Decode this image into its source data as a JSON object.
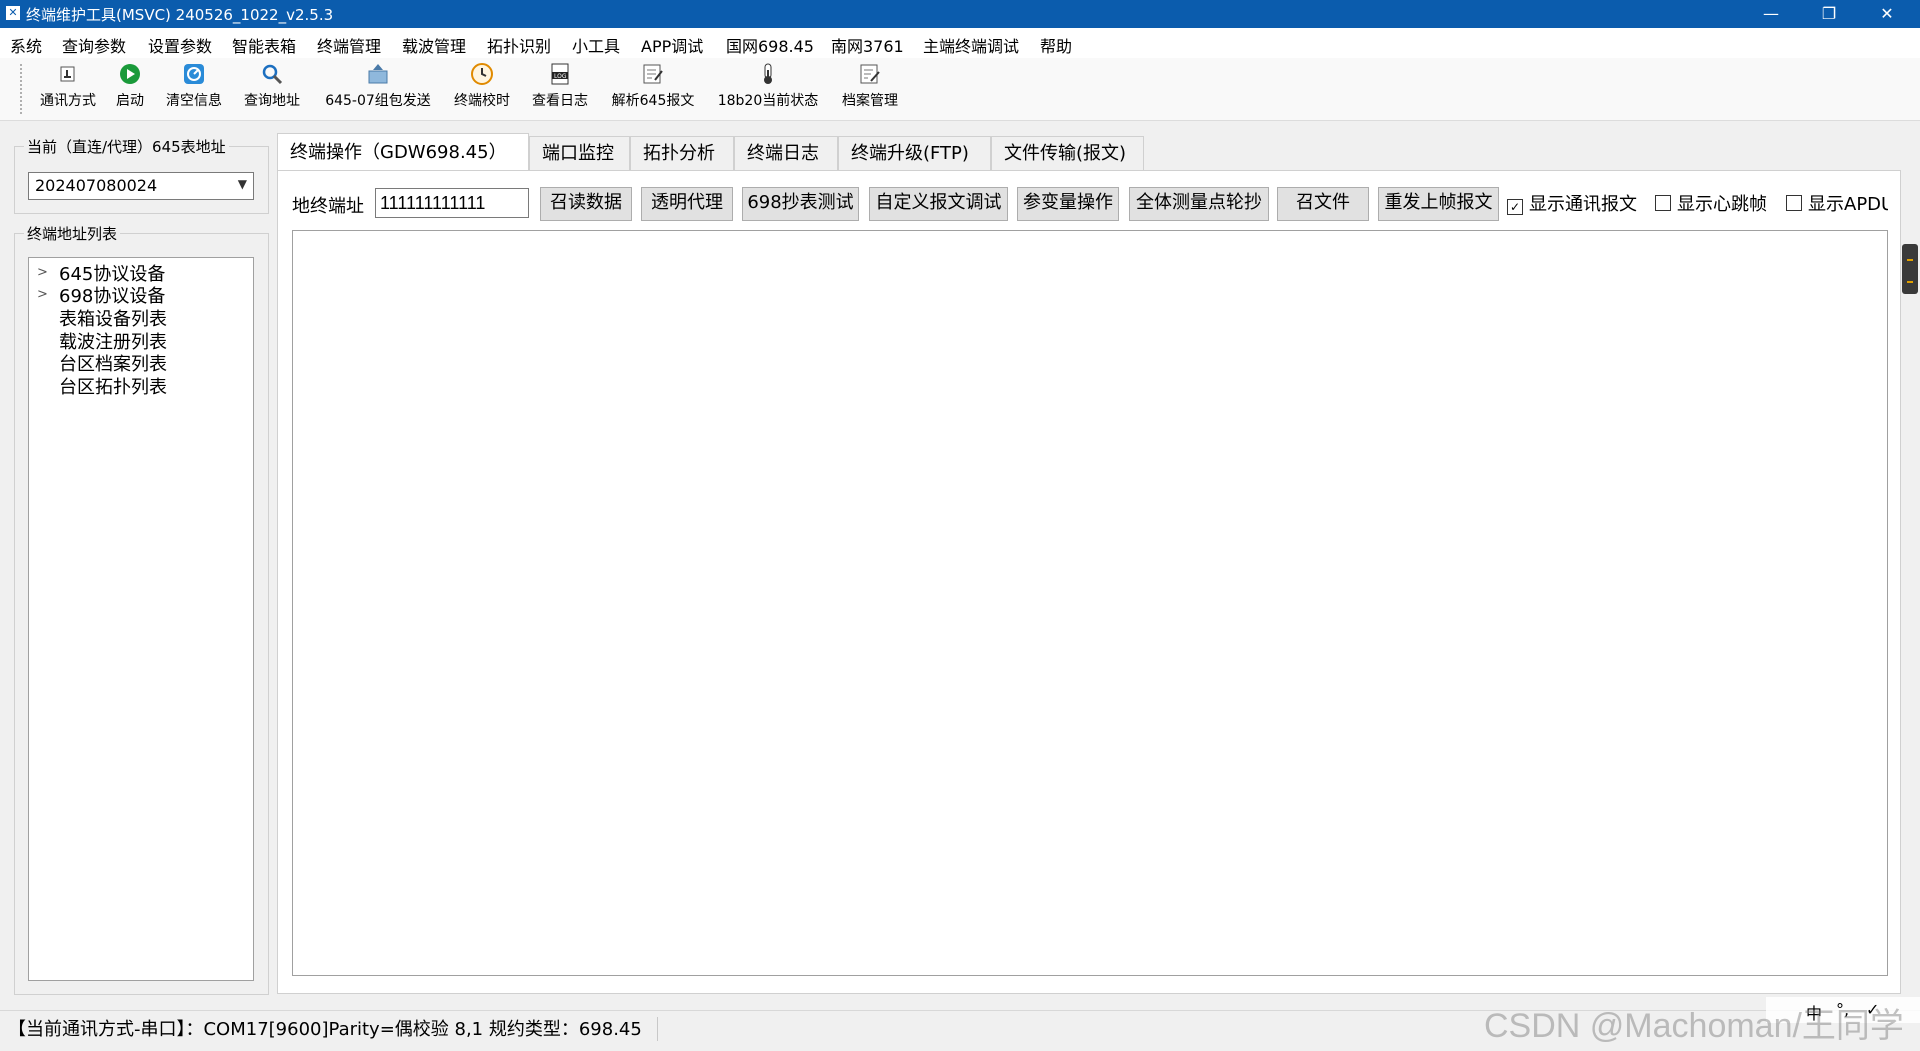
{
  "window": {
    "title": "终端维护工具(MSVC) 240526_1022_v2.5.3",
    "minimize": "—",
    "restore": "❐",
    "close": "✕"
  },
  "menu": [
    "系统",
    "查询参数",
    "设置参数",
    "智能表箱",
    "终端管理",
    "载波管理",
    "拓扑识别",
    "小工具",
    "APP调试",
    "国网698.45",
    "南网3761",
    "主端终端调试",
    "帮助"
  ],
  "toolbar": [
    {
      "label": "通讯方式",
      "icon": "connection-icon"
    },
    {
      "label": "启动",
      "icon": "play-icon"
    },
    {
      "label": "清空信息",
      "icon": "clear-icon"
    },
    {
      "label": "查询地址",
      "icon": "search-icon"
    },
    {
      "label": "645-07组包发送",
      "icon": "send-package-icon"
    },
    {
      "label": "终端校时",
      "icon": "clock-icon"
    },
    {
      "label": "查看日志",
      "icon": "log-icon"
    },
    {
      "label": "解析645报文",
      "icon": "parse-icon"
    },
    {
      "label": "18b20当前状态",
      "icon": "thermometer-icon"
    },
    {
      "label": "档案管理",
      "icon": "archive-icon"
    }
  ],
  "left": {
    "current_group_title": "当前（直连/代理）645表地址",
    "current_address": "202407080024",
    "list_group_title": "终端地址列表",
    "tree": [
      {
        "label": "645协议设备",
        "expandable": true
      },
      {
        "label": "698协议设备",
        "expandable": true
      },
      {
        "label": "表箱设备列表",
        "expandable": false
      },
      {
        "label": "载波注册列表",
        "expandable": false
      },
      {
        "label": "台区档案列表",
        "expandable": false
      },
      {
        "label": "台区拓扑列表",
        "expandable": false
      }
    ]
  },
  "tabs": [
    "终端操作（GDW698.45）",
    "端口监控",
    "拓扑分析",
    "终端日志",
    "终端升级(FTP)",
    "文件传输(报文)"
  ],
  "operation": {
    "address_label": "地终端址",
    "address_value": "111111111111",
    "buttons": [
      "召读数据",
      "透明代理",
      "698抄表测试",
      "自定义报文调试",
      "参变量操作",
      "全体测量点轮抄",
      "召文件",
      "重发上帧报文"
    ],
    "checkboxes": [
      {
        "label": "显示通讯报文",
        "checked": true
      },
      {
        "label": "显示心跳帧",
        "checked": false
      },
      {
        "label": "显示APDU",
        "checked": false
      }
    ]
  },
  "status": {
    "text": "【当前通讯方式-串口】：COM17[9600]Parity=偶校验 8,1 规约类型：698.45"
  },
  "watermark": "CSDN @Machoman/王同学",
  "ime": [
    "中",
    "°,",
    "✓"
  ]
}
